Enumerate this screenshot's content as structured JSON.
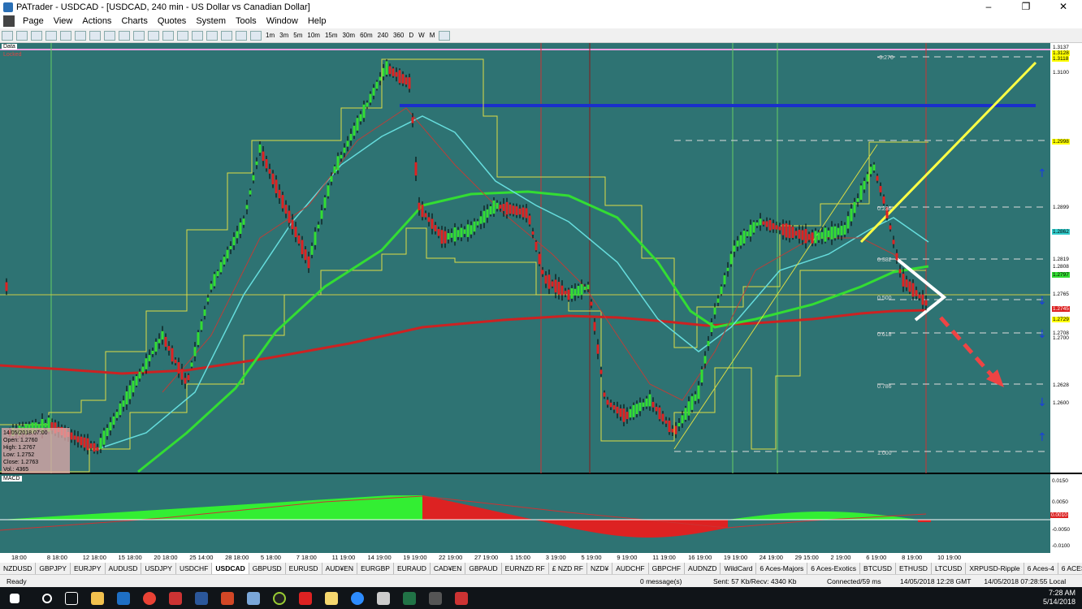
{
  "window": {
    "title": "PATrader - USDCAD - [USDCAD, 240 min - US Dollar vs Canadian Dollar]"
  },
  "menu": [
    "Page",
    "View",
    "Actions",
    "Charts",
    "Quotes",
    "System",
    "Tools",
    "Window",
    "Help"
  ],
  "timeframes": [
    "1m",
    "3m",
    "5m",
    "10m",
    "15m",
    "30m",
    "60m",
    "240",
    "360",
    "D",
    "W",
    "M"
  ],
  "chart": {
    "top_labels": [
      "Data",
      "Locked"
    ],
    "price_labels": [
      {
        "text": "1.3137",
        "bg": "#ffffff"
      },
      {
        "text": "1.3128",
        "bg": "#ffff00"
      },
      {
        "text": "1.3118",
        "bg": "#ffff00"
      },
      {
        "text": "1.3100",
        "bg": "none"
      },
      {
        "text": "1.2998",
        "bg": "#ffff00"
      },
      {
        "text": "1.2899",
        "bg": "#ffffff"
      },
      {
        "text": "1.2862",
        "bg": "#33cccc"
      },
      {
        "text": "1.2819",
        "bg": "#ffffff"
      },
      {
        "text": "1.2808",
        "bg": "#ffffff"
      },
      {
        "text": "1.2797",
        "bg": "#33dd33"
      },
      {
        "text": "1.2765",
        "bg": "#ffffff"
      },
      {
        "text": "1.2745",
        "bg": "#dd2222"
      },
      {
        "text": "1.2729",
        "bg": "#ffff00"
      },
      {
        "text": "1.2708",
        "bg": "#ffffff"
      },
      {
        "text": "1.2700",
        "bg": "none"
      },
      {
        "text": "1.2628",
        "bg": "#ffffff"
      },
      {
        "text": "1.2600",
        "bg": "none"
      }
    ],
    "fib_labels": [
      "-0.270",
      "0.236",
      "0.382",
      "0.500",
      "0.618",
      "0.786",
      "1.000"
    ],
    "date_labels": [
      "18:00",
      "8 18:00",
      "12 18:00",
      "15 18:00",
      "20 18:00",
      "25 14:00",
      "28 18:00",
      "5 18:00",
      "7 18:00",
      "11 19:00",
      "14 19:00",
      "19 19:00",
      "22 19:00",
      "27 19:00",
      "1 15:00",
      "3 19:00",
      "5 19:00",
      "9 19:00",
      "11 19:00",
      "16 19:00",
      "19 19:00",
      "24 19:00",
      "29 15:00",
      "2 19:00",
      "6 19:00",
      "8 19:00",
      "10 19:00"
    ],
    "ohlc": {
      "date": "14/05/2018 07:00",
      "open": "Open: 1.2760",
      "high": "High: 1.2767",
      "low": "Low: 1.2752",
      "close": "Close: 1.2763",
      "vol": "Vol.: 4365"
    },
    "macd": {
      "label": "MACD",
      "scale": [
        "0.0150",
        "0.0050",
        "-0.0050",
        "-0.0100"
      ],
      "current": "0.0010"
    }
  },
  "tabs": [
    "NZDUSD",
    "GBPJPY",
    "EURJPY",
    "AUDUSD",
    "USDJPY",
    "USDCHF",
    "USDCAD",
    "GBPUSD",
    "EURUSD",
    "AUD¥EN",
    "EURGBP",
    "EURAUD",
    "CAD¥EN",
    "GBPAUD",
    "EURNZD RF",
    "£ NZD RF",
    "NZD¥",
    "AUDCHF",
    "GBPCHF",
    "AUDNZD",
    "WildCard",
    "6 Aces-Majors",
    "6 Aces-Exotics",
    "BTCUSD",
    "ETHUSD",
    "LTCUSD",
    "XRPUSD-Ripple",
    "6 Aces-4",
    "6 ACES 2"
  ],
  "active_tab": "USDCAD",
  "status": {
    "ready": "Ready",
    "messages": "0 message(s)",
    "traffic": "Sent: 57 Kb/Recv: 4340 Kb",
    "connected": "Connected/59 ms",
    "server_time": "14/05/2018 12:28 GMT",
    "local_time": "14/05/2018 07:28:55 Local"
  },
  "taskbar": {
    "time": "7:28 AM",
    "date": "5/14/2018"
  }
}
